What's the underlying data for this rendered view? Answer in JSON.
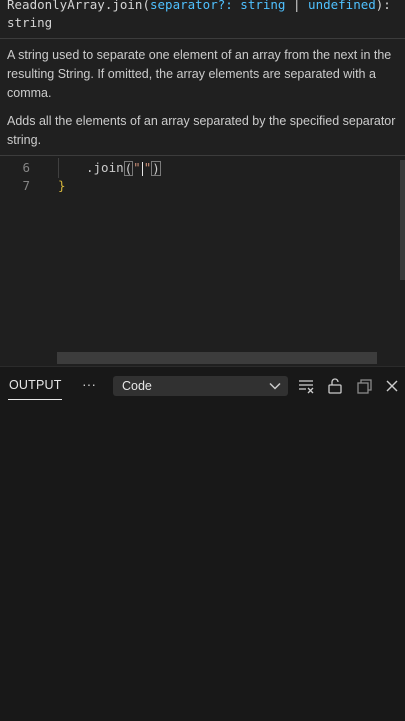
{
  "hover": {
    "sig_prefix": "ReadonlyArray.join(",
    "sig_param": "separator?: string",
    "sig_pipe": " | ",
    "sig_undefined": "undefined",
    "sig_suffix": "):",
    "sig_return": "string",
    "param_doc": "A string used to separate one element of an array from the next in the resulting String. If omitted, the array elements are separated with a comma.",
    "method_doc": "Adds all the elements of an array separated by the specified separator string."
  },
  "editor": {
    "lines": [
      {
        "number": "6",
        "text": ".join",
        "args": "\"\""
      },
      {
        "number": "7",
        "text": "}"
      }
    ]
  },
  "panel": {
    "tab_label": "OUTPUT",
    "more_label": "···",
    "channel_selected": "Code",
    "icons": [
      "clear-output-icon",
      "lock-scroll-icon",
      "maximize-panel-icon",
      "close-icon"
    ]
  },
  "colors": {
    "editor_bg": "#1f1f1f",
    "panel_bg": "#181818",
    "param_blue": "#4fc1ff",
    "brace_yellow": "#d4b53c"
  }
}
